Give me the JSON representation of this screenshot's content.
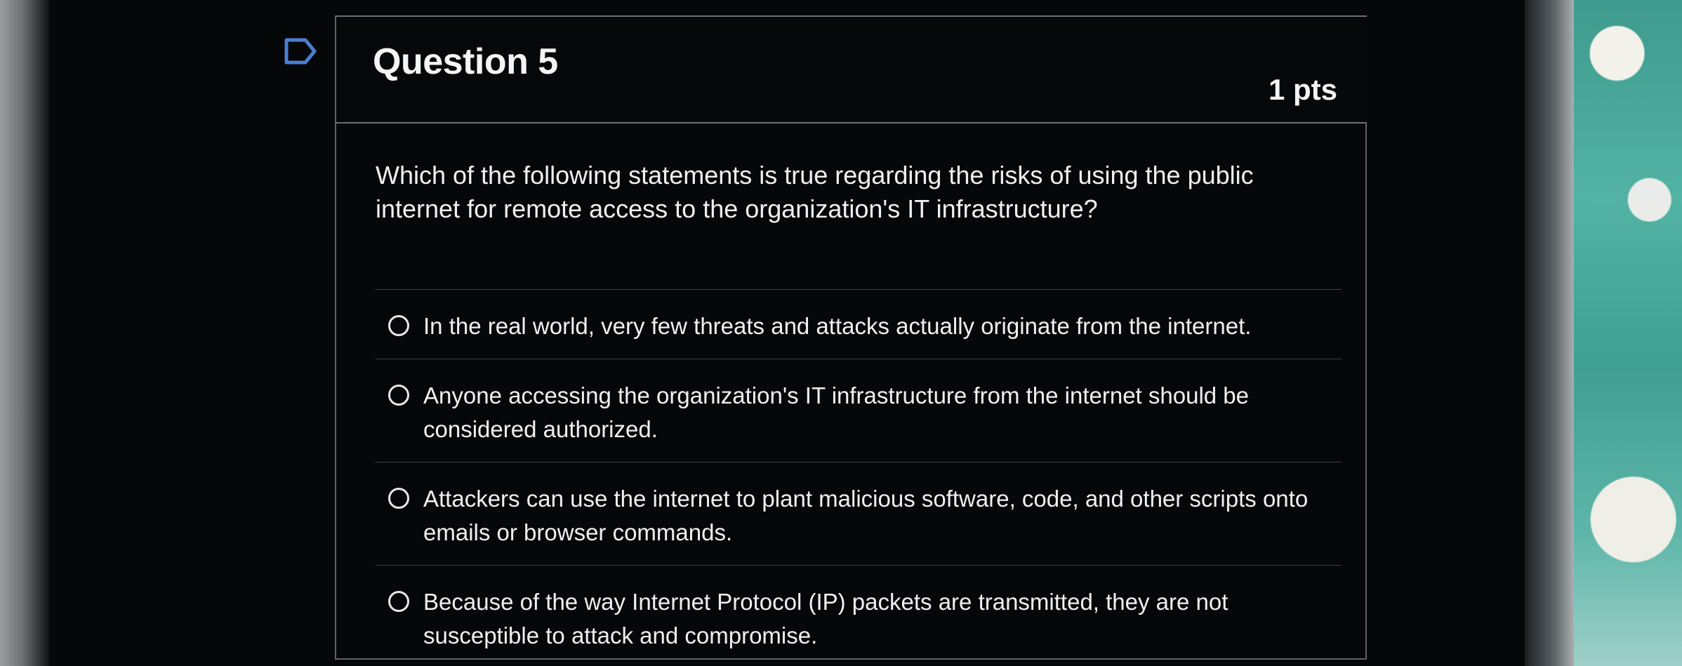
{
  "question": {
    "title": "Question 5",
    "points": "1 pts",
    "text": "Which of the following statements is true regarding the risks of using the public internet for remote access to the organization's IT infrastructure?",
    "answers": [
      "In the real world, very few threats and attacks actually originate from the internet.",
      "Anyone accessing the organization's IT infrastructure from the internet should be considered authorized.",
      "Attackers can use the internet to plant malicious software, code, and other scripts onto emails or browser commands.",
      "Because of the way Internet Protocol (IP) packets are transmitted, they are not susceptible to attack and compromise."
    ]
  },
  "icons": {
    "flag": "flag-icon",
    "radio": "radio-unselected-icon"
  },
  "colors": {
    "background": "#060708",
    "text": "#eef0f2",
    "border": "#5d646c",
    "flag": "#4a7fd0"
  }
}
